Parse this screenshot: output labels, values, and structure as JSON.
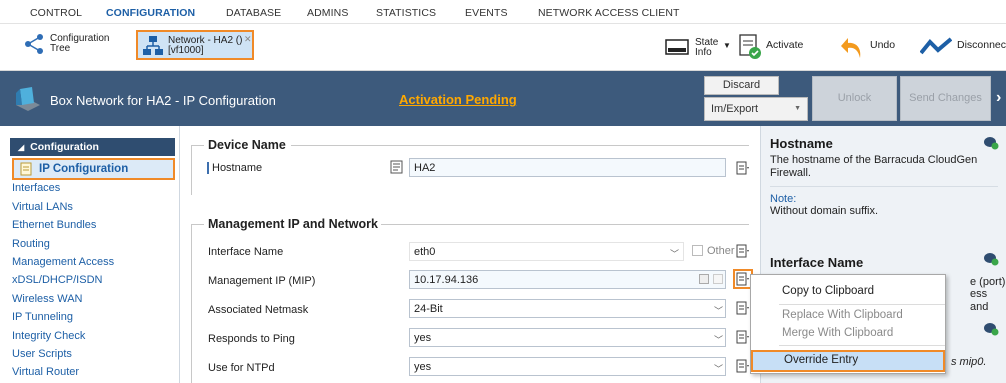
{
  "menu": {
    "items": [
      "CONTROL",
      "CONFIGURATION",
      "DATABASE",
      "ADMINS",
      "STATISTICS",
      "EVENTS",
      "NETWORK ACCESS CLIENT"
    ],
    "active": "CONFIGURATION"
  },
  "toolbar": {
    "config_tree_line1": "Configuration",
    "config_tree_line2": "Tree",
    "network_tab_line1": "Network - HA2 ()",
    "network_tab_line2": "[vf1000]",
    "state_info_line1": "State",
    "state_info_line2": "Info",
    "activate": "Activate",
    "undo": "Undo",
    "disconnect": "Disconnec"
  },
  "header": {
    "title": "Box Network for HA2 - IP Configuration",
    "pending": "Activation Pending",
    "discard": "Discard",
    "im_export": "Im/Export",
    "unlock": "Unlock",
    "send_changes": "Send Changes"
  },
  "nav": {
    "heading": "Configuration",
    "items": [
      "IP Configuration",
      "Interfaces",
      "Virtual LANs",
      "Ethernet Bundles",
      "Routing",
      "Management Access",
      "xDSL/DHCP/ISDN",
      "Wireless WAN",
      "IP Tunneling",
      "Integrity Check",
      "User Scripts",
      "Virtual Router"
    ],
    "selected": "IP Configuration"
  },
  "form": {
    "device_section": "Device Name",
    "hostname_label": "Hostname",
    "hostname_value": "HA2",
    "mgmt_section": "Management IP and Network",
    "interface_label": "Interface Name",
    "interface_value": "eth0",
    "other_label": "Other",
    "mip_label": "Management IP (MIP)",
    "mip_value": "10.17.94.136",
    "netmask_label": "Associated Netmask",
    "netmask_value": "24-Bit",
    "ping_label": "Responds to Ping",
    "ping_value": "yes",
    "ntp_label": "Use for NTPd",
    "ntp_value": "yes"
  },
  "help": {
    "hostname_title": "Hostname",
    "hostname_text1": "The hostname of the Barracuda CloudGen",
    "hostname_text2": "Firewall.",
    "note_label": "Note:",
    "note_text": "Without domain suffix.",
    "interface_title": "Interface Name",
    "interface_frag1": "e (port)",
    "interface_frag2": "ess and",
    "mip_frag": "s mip0."
  },
  "context_menu": {
    "items": [
      "Copy to Clipboard",
      "Replace With Clipboard",
      "Merge With Clipboard",
      "Override Entry"
    ],
    "highlighted": "Override Entry"
  },
  "colors": {
    "brand_blue": "#1d5fa6",
    "header_bg": "#3d5a7c",
    "pending": "#ffa800",
    "highlight": "#f08a28"
  },
  "icons": [
    "configuration-tree-icon",
    "network-icon",
    "state-info-icon",
    "activate-icon",
    "undo-icon",
    "disconnect-icon",
    "box-network-icon",
    "clipboard-icon",
    "hostname-icon",
    "add-help-icon"
  ]
}
